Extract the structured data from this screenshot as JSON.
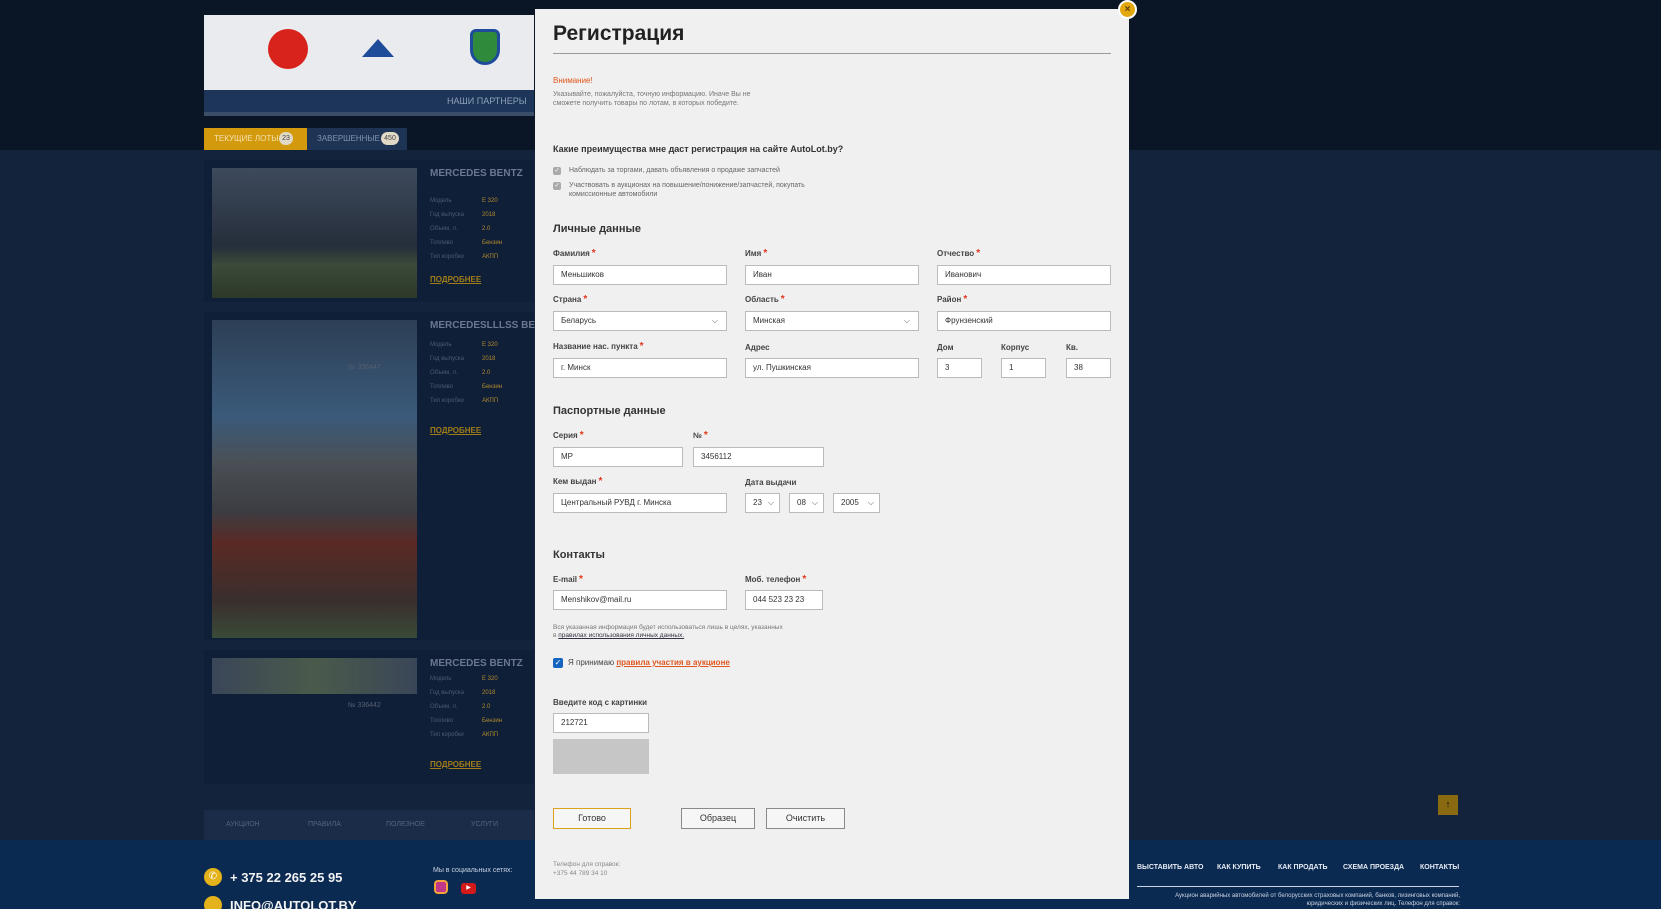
{
  "background": {
    "partners_label": "НАШИ ПАРТНЕРЫ",
    "tabs": [
      {
        "label": "ТЕКУЩИЕ ЛОТЫ",
        "count": "23"
      },
      {
        "label": "ЗАВЕРШЕННЫЕ",
        "count": "450"
      }
    ],
    "spec_labels": [
      "Модель",
      "Год выпуска",
      "Объем, л.",
      "Топливо",
      "Тип коробки"
    ],
    "lots": [
      {
        "title": "MERCEDES BENTZ",
        "specs": [
          "E 320",
          "2018",
          "2.0",
          "Бензин",
          "АКПП"
        ],
        "more": "ПОДРОБНЕЕ",
        "num": ""
      },
      {
        "title": "MERCEDESLLLSS BENTZ",
        "specs": [
          "E 320",
          "2018",
          "2.0",
          "Бензин",
          "АКПП"
        ],
        "more": "ПОДРОБНЕЕ",
        "num": "№ 336447"
      },
      {
        "title": "MERCEDES BENTZ",
        "specs": [
          "E 320",
          "2018",
          "2.0",
          "Бензин",
          "АКПП"
        ],
        "more": "ПОДРОБНЕЕ",
        "num": "№ 336442"
      }
    ],
    "bottom_nav": [
      "АУКЦИОН",
      "ПРАВИЛА",
      "ПОЛЕЗНОЕ",
      "УСЛУГИ"
    ],
    "footer": {
      "phone": "+ 375 22 265 25 95",
      "email": "INFO@AUTOLOT.BY",
      "social_label": "Мы в социальных сетях:",
      "links": [
        "ВЫСТАВИТЬ АВТО",
        "КАК КУПИТЬ",
        "КАК ПРОДАТЬ",
        "СХЕМА ПРОЕЗДА",
        "КОНТАКТЫ"
      ],
      "description": "Аукцион аварийных автомобилей от белорусских страховых компаний, банков, лизинговых компаний, юридических и физических лиц. Телефон для справок:"
    }
  },
  "modal": {
    "title": "Регистрация",
    "close_symbol": "×",
    "warning_title": "Внимание!",
    "warning_text": "Указывайте, пожалуйста, точную информацию. Иначе Вы не сможете получить товары по лотам, в которых победите.",
    "benefits_question": "Какие преимущества мне даст регистрация на сайте AutoLot.by?",
    "benefits": [
      "Наблюдать за торгами, давать объявления о продаже запчастей",
      "Участвовать в аукционах на повышение/понижение/запчастей, покупать комиссионные автомобили"
    ],
    "personal": {
      "heading": "Личные данные",
      "surname_label": "Фамилия",
      "surname": "Меньшиков",
      "name_label": "Имя",
      "name": "Иван",
      "patronymic_label": "Отчество",
      "patronymic": "Иванович",
      "country_label": "Страна",
      "country": "Беларусь",
      "region_label": "Область",
      "region": "Минская",
      "district_label": "Район",
      "district": "Фрунзенский",
      "city_label": "Название нас. пункта",
      "city": "г. Минск",
      "address_label": "Адрес",
      "address": "ул. Пушкинская",
      "house_label": "Дом",
      "house": "3",
      "building_label": "Корпус",
      "building": "1",
      "apt_label": "Кв.",
      "apt": "38"
    },
    "passport": {
      "heading": "Паспортные данные",
      "series_label": "Серия",
      "series": "МР",
      "number_label": "№",
      "number": "3456112",
      "issued_by_label": "Кем выдан",
      "issued_by": "Центральный РУВД г. Минска",
      "issue_date_label": "Дата выдачи",
      "day": "23",
      "month": "08",
      "year": "2005"
    },
    "contacts": {
      "heading": "Контакты",
      "email_label": "E-mail",
      "email": "Menshikov@mail.ru",
      "phone_label": "Моб. телефон",
      "phone": "044 523 23 23"
    },
    "consent_note_prefix": "Вся указанная информация будет использоваться лишь в целях, указанных в",
    "consent_note_link": "правилах использования личных данных.",
    "agree_prefix": "Я принимаю",
    "agree_link": "правила участия в аукционе",
    "captcha_label": "Введите код с картинки",
    "captcha_value": "212721",
    "buttons": {
      "submit": "Готово",
      "sample": "Образец",
      "clear": "Очистить"
    },
    "help_label": "Телефон для справок:",
    "help_phone": "+375 44 789 34 10"
  },
  "colors": {
    "accent": "#e3a70f",
    "warning": "#e0561e",
    "required": "#e0341a",
    "footer_bg": "#0b2a52"
  }
}
